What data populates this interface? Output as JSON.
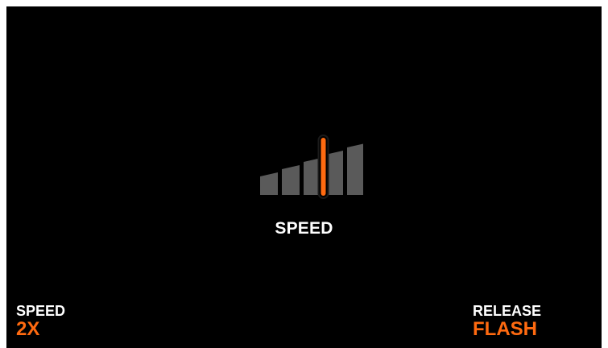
{
  "screen": {
    "label": "SPEED",
    "accent_color": "#FF6A10",
    "bar_color": "#5A5A5A",
    "bar_count": 5,
    "active_bar": 4,
    "icon": "speed-level-bars-icon"
  },
  "left_param": {
    "caption": "SPEED",
    "value": "2X"
  },
  "right_param": {
    "caption": "RELEASE",
    "value": "FLASH"
  }
}
